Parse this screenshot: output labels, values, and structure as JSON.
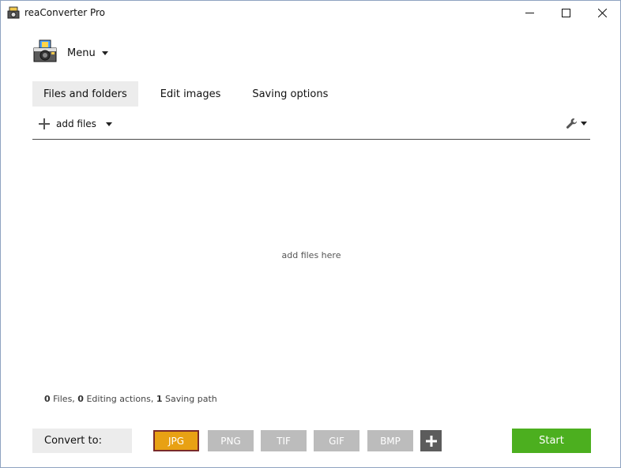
{
  "window": {
    "title": "reaConverter Pro",
    "icons": {
      "app": "camera-app-icon",
      "minimize": "minimize-icon",
      "maximize": "maximize-icon",
      "close": "close-icon"
    }
  },
  "menu": {
    "label": "Menu"
  },
  "tabs": [
    {
      "label": "Files and folders",
      "active": true
    },
    {
      "label": "Edit images",
      "active": false
    },
    {
      "label": "Saving options",
      "active": false
    }
  ],
  "toolbar": {
    "add_files_label": "add files"
  },
  "dropzone": {
    "hint": "add files here"
  },
  "status": {
    "files_count": "0",
    "files_label": "Files,",
    "editing_count": "0",
    "editing_label": "Editing actions,",
    "saving_count": "1",
    "saving_label": "Saving path"
  },
  "convert": {
    "label": "Convert to:",
    "formats": [
      {
        "label": "JPG",
        "active": true
      },
      {
        "label": "PNG",
        "active": false
      },
      {
        "label": "TIF",
        "active": false
      },
      {
        "label": "GIF",
        "active": false
      },
      {
        "label": "BMP",
        "active": false
      }
    ],
    "start_label": "Start"
  },
  "colors": {
    "active_format": "#e8a114",
    "active_format_border": "#7a2a2a",
    "inactive_format": "#bcbcbc",
    "start": "#4caf1f",
    "tab_active_bg": "#ececec"
  }
}
